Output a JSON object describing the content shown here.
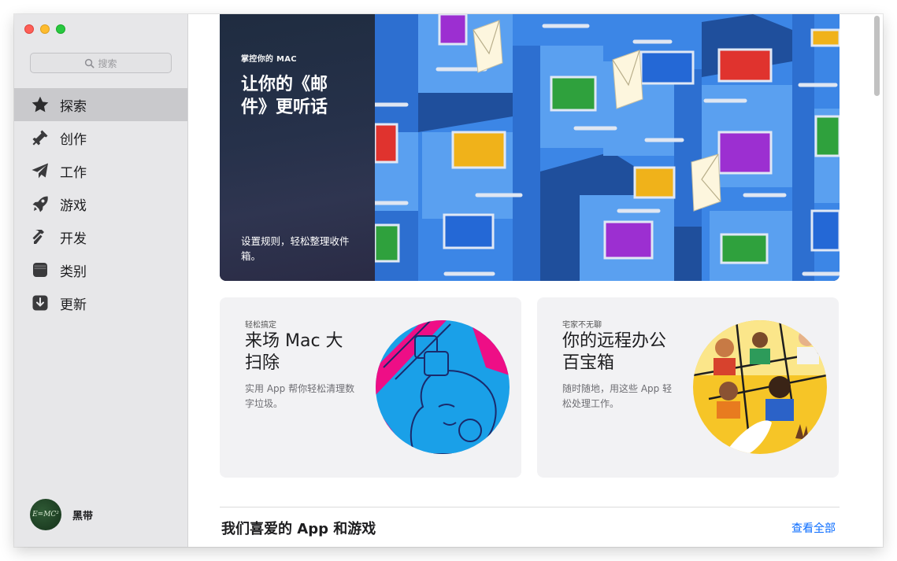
{
  "search": {
    "placeholder": "搜索"
  },
  "sidebar": {
    "items": [
      {
        "label": "探索",
        "icon": "star-icon",
        "active": true
      },
      {
        "label": "创作",
        "icon": "brush-icon",
        "active": false
      },
      {
        "label": "工作",
        "icon": "paper-plane-icon",
        "active": false
      },
      {
        "label": "游戏",
        "icon": "rocket-icon",
        "active": false
      },
      {
        "label": "开发",
        "icon": "hammer-icon",
        "active": false
      },
      {
        "label": "类别",
        "icon": "stack-icon",
        "active": false
      },
      {
        "label": "更新",
        "icon": "download-icon",
        "active": false
      }
    ]
  },
  "user": {
    "name": "黑带",
    "avatar_text": "E=MC²"
  },
  "hero": {
    "eyebrow": "掌控你的 MAC",
    "title": "让你的《邮件》更听话",
    "description": "设置规则，轻松整理收件箱。"
  },
  "cards": [
    {
      "eyebrow": "轻松搞定",
      "title": "来场 Mac 大扫除",
      "description": "实用 App 帮你轻松清理数字垃圾。"
    },
    {
      "eyebrow": "宅家不无聊",
      "title": "你的远程办公百宝箱",
      "description": "随时随地，用这些 App 轻松处理工作。"
    }
  ],
  "section": {
    "title": "我们喜爱的 App 和游戏",
    "see_all": "查看全部"
  },
  "colors": {
    "accent": "#0a6cff",
    "sidebar_bg": "#e7e7e9",
    "sidebar_active": "#c9c9cc"
  }
}
